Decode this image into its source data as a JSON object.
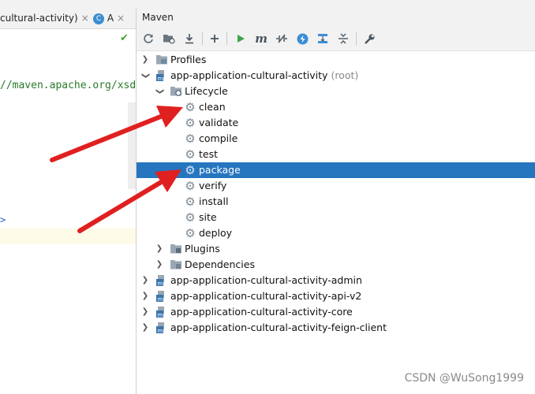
{
  "editor": {
    "tab1_label": "cultural-activity)",
    "tab2_label": "A",
    "tab2_icon": "C",
    "code_url": "//maven.apache.org/xsd",
    "code_gt": ">"
  },
  "maven": {
    "title": "Maven",
    "toolbar": [
      {
        "name": "reload-icon"
      },
      {
        "name": "generate-sources-icon"
      },
      {
        "name": "download-icon"
      },
      {
        "name": "add-icon"
      },
      {
        "name": "run-icon"
      },
      {
        "name": "execute-goal-icon"
      },
      {
        "name": "toggle-offline-icon"
      },
      {
        "name": "skip-tests-icon"
      },
      {
        "name": "show-dependencies-icon"
      },
      {
        "name": "collapse-all-icon"
      },
      {
        "name": "settings-icon"
      }
    ],
    "tree": {
      "profiles": "Profiles",
      "root_project": "app-application-cultural-activity",
      "root_tag": "(root)",
      "lifecycle": "Lifecycle",
      "goals": [
        "clean",
        "validate",
        "compile",
        "test",
        "package",
        "verify",
        "install",
        "site",
        "deploy"
      ],
      "selected_goal": "package",
      "plugins": "Plugins",
      "dependencies": "Dependencies",
      "modules": [
        "app-application-cultural-activity-admin",
        "app-application-cultural-activity-api-v2",
        "app-application-cultural-activity-core",
        "app-application-cultural-activity-feign-client"
      ]
    }
  },
  "watermark": "CSDN @WuSong1999",
  "colors": {
    "selection": "#2675bf",
    "arrow_annotation": "#e02020"
  }
}
